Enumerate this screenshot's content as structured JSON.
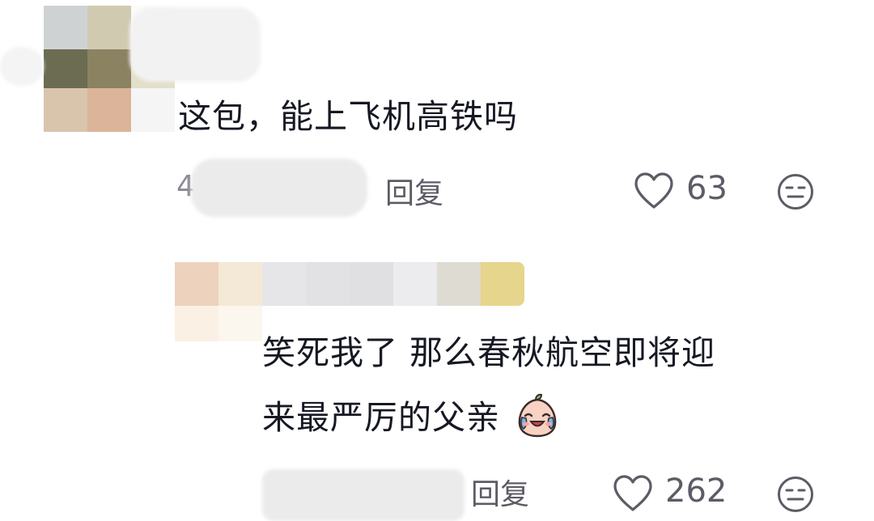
{
  "comments": [
    {
      "text": "这包，能上飞机高铁吗",
      "reply_label": "回复",
      "like_count": "63",
      "date_visible_fragment": "4"
    },
    {
      "text_line1": "笑死我了 那么春秋航空即将迎",
      "text_line2": "来最严厉的父亲",
      "reply_label": "回复",
      "like_count": "262"
    }
  ],
  "icons": {
    "like": "heart-outline-icon",
    "dislike": "neutral-face-icon",
    "emoji": "crying-laughing-peach-emoji"
  },
  "colors": {
    "text": "#161823",
    "secondary": "#5c5c66",
    "background": "#ffffff"
  }
}
